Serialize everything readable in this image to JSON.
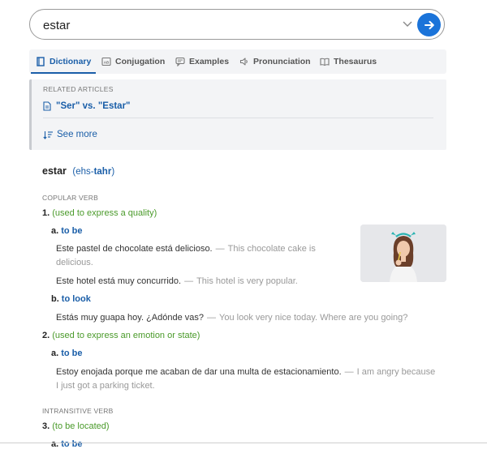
{
  "search": {
    "value": "estar"
  },
  "tabs": [
    {
      "label": "Dictionary",
      "icon": "book-icon",
      "active": true
    },
    {
      "label": "Conjugation",
      "icon": "conjugation-icon"
    },
    {
      "label": "Examples",
      "icon": "speech-bubbles-icon"
    },
    {
      "label": "Pronunciation",
      "icon": "speaker-icon"
    },
    {
      "label": "Thesaurus",
      "icon": "open-book-icon"
    }
  ],
  "related": {
    "title": "RELATED ARTICLES",
    "link": "\"Ser\" vs. \"Estar\"",
    "see_more": "See more"
  },
  "entry": {
    "headword": "estar",
    "pron_open": "(ehs-",
    "pron_stress": "tahr",
    "pron_close": ")",
    "pos1": "COPULAR VERB",
    "sense1": {
      "num": "1.",
      "gloss": "(used to express a quality)"
    },
    "sense1a": {
      "letter": "a.",
      "label": "to be"
    },
    "ex1": {
      "es": "Este pastel de chocolate está delicioso.",
      "en1": "This chocolate cake is",
      "en2": "delicious."
    },
    "ex2": {
      "es": "Este hotel está muy concurrido.",
      "en": "This hotel is very popular."
    },
    "sense1b": {
      "letter": "b.",
      "label": "to look"
    },
    "ex3": {
      "es": "Estás muy guapa hoy. ¿Adónde vas?",
      "en": "You look very nice today. Where are you going?"
    },
    "sense2": {
      "num": "2.",
      "gloss": "(used to express an emotion or state)"
    },
    "sense2a": {
      "letter": "a.",
      "label": "to be"
    },
    "ex4": {
      "es": "Estoy enojada porque me acaban de dar una multa de estacionamiento.",
      "en1": "I am angry because",
      "en2": "I just got a parking ticket."
    },
    "pos2": "INTRANSITIVE VERB",
    "sense3": {
      "num": "3.",
      "gloss": "(to be located)"
    },
    "sense3a": {
      "letter": "a.",
      "label": "to be"
    }
  },
  "dash": "—",
  "colors": {
    "accent": "#1a5ea8",
    "button": "#1a73d9",
    "gloss": "#4a9a2a"
  }
}
